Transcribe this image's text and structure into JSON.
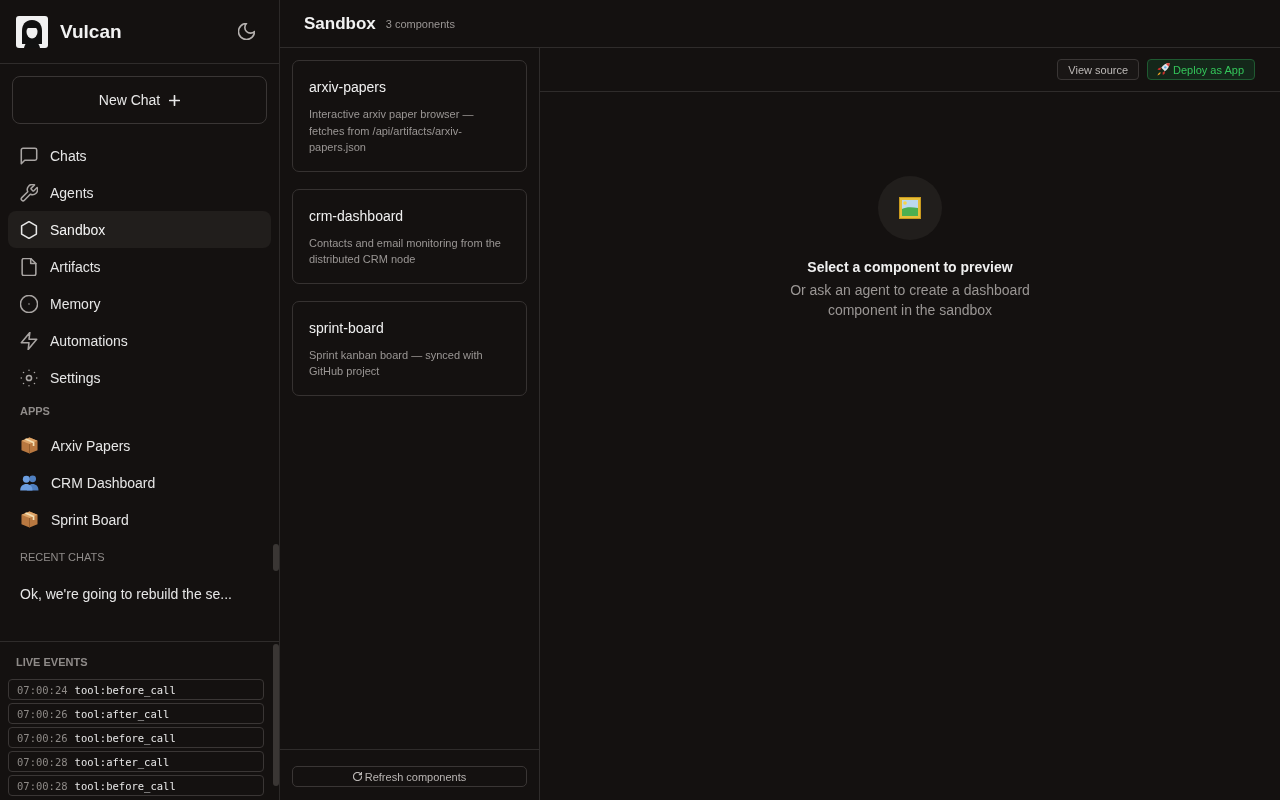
{
  "sidebar": {
    "brand": {
      "name": "Vulcan"
    },
    "new_chat_button": {
      "label": "New Chat"
    },
    "nav": [
      {
        "label": "Chats",
        "selected": false
      },
      {
        "label": "Agents",
        "selected": false
      },
      {
        "label": "Sandbox",
        "selected": true
      },
      {
        "label": "Artifacts",
        "selected": false
      },
      {
        "label": "Memory",
        "selected": false
      },
      {
        "label": "Automations",
        "selected": false
      },
      {
        "label": "Settings",
        "selected": false
      }
    ],
    "apps_heading": "APPS",
    "apps": [
      {
        "label": "Arxiv Papers",
        "kind": "package"
      },
      {
        "label": "CRM Dashboard",
        "kind": "people"
      },
      {
        "label": "Sprint Board",
        "kind": "package"
      }
    ],
    "recent_heading": "RECENT CHATS",
    "recent_chats": [
      {
        "title": "Ok, we're going to rebuild the se..."
      }
    ]
  },
  "live_events": {
    "heading": "LIVE EVENTS",
    "events": [
      {
        "time": "07:00:24",
        "name": "tool:before_call"
      },
      {
        "time": "07:00:26",
        "name": "tool:after_call"
      },
      {
        "time": "07:00:26",
        "name": "tool:before_call"
      },
      {
        "time": "07:00:28",
        "name": "tool:after_call"
      },
      {
        "time": "07:00:28",
        "name": "tool:before_call"
      }
    ]
  },
  "header": {
    "title": "Sandbox",
    "count": "3 components"
  },
  "components": [
    {
      "name": "arxiv-papers",
      "description": "Interactive arxiv paper browser — fetches from /api/artifacts/arxiv-papers.json",
      "selected": false
    },
    {
      "name": "crm-dashboard",
      "description": "Contacts and email monitoring from the distributed CRM node",
      "selected": false
    },
    {
      "name": "sprint-board",
      "description": "Sprint kanban board — synced with GitHub project",
      "selected": false
    }
  ],
  "refresh_button": {
    "label": "Refresh components"
  },
  "toolbar": {
    "buttons": [
      {
        "label": "View source",
        "kind": "outline"
      },
      {
        "label": "Deploy as App",
        "kind": "deploy"
      }
    ]
  },
  "preview": {
    "title": "Select a component to preview",
    "hint": "Or ask an agent to create a dashboard component in the sandbox"
  }
}
